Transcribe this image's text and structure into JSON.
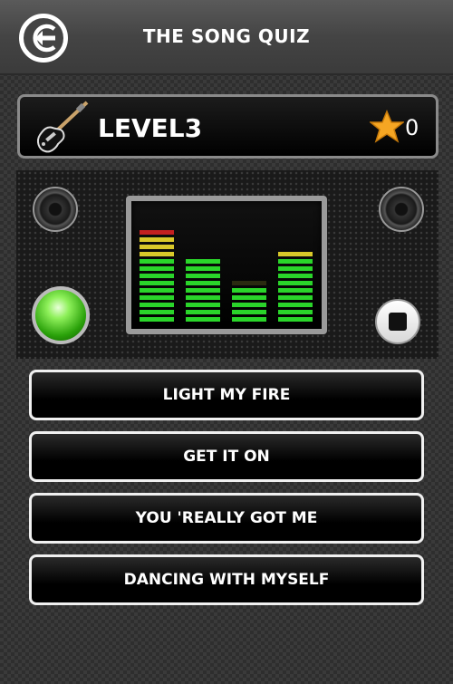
{
  "header": {
    "title": "THE SONG QUIZ",
    "back_icon": "back-arrow-icon"
  },
  "level": {
    "label": "LEVEL3",
    "icon": "guitar-icon",
    "star_icon": "star-icon",
    "star_count": "0"
  },
  "player": {
    "play_button_color": "#3cc21a",
    "stop_icon": "stop-icon",
    "equalizer_levels": [
      0.87,
      0.58,
      0.33,
      0.67
    ]
  },
  "answers": [
    {
      "label": "LIGHT MY FIRE"
    },
    {
      "label": "GET IT ON"
    },
    {
      "label": "YOU 'REALLY GOT ME"
    },
    {
      "label": "DANCING WITH MYSELF"
    }
  ],
  "colors": {
    "accent_star": "#f5a623",
    "eq_green": "#2ad52a",
    "eq_yellow": "#d9c82a",
    "eq_red": "#c42020"
  }
}
